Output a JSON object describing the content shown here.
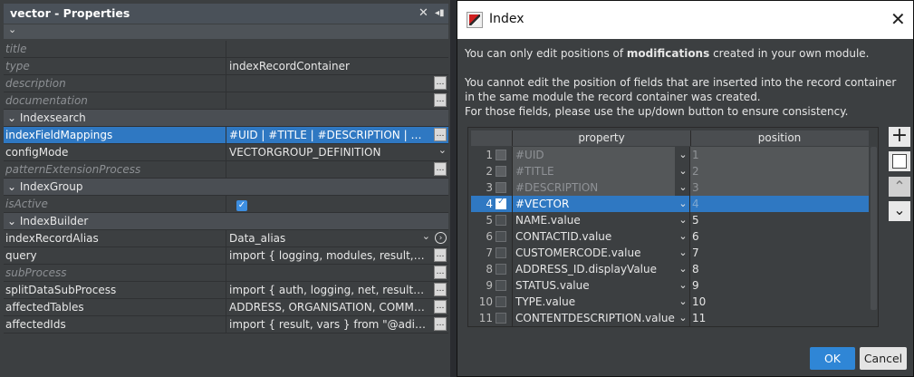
{
  "properties": {
    "title": "vector - Properties",
    "rows": [
      {
        "label": "title",
        "value": "",
        "muted": true,
        "ellipsis": false
      },
      {
        "label": "type",
        "value": "indexRecordContainer",
        "muted": true,
        "ellipsis": false
      },
      {
        "label": "description",
        "value": "",
        "muted": true,
        "ellipsis": true
      },
      {
        "label": "documentation",
        "value": "",
        "muted": true,
        "ellipsis": true
      }
    ],
    "sections": {
      "indexsearch": "Indexsearch",
      "indexgroup": "IndexGroup",
      "indexbuilder": "IndexBuilder"
    },
    "indexFieldMappings": {
      "label": "indexFieldMappings",
      "value": "#UID | #TITLE | #DESCRIPTION | #VECTOR"
    },
    "configMode": {
      "label": "configMode",
      "value": "VECTORGROUP_DEFINITION"
    },
    "patternExtensionProcess": {
      "label": "patternExtensionProcess",
      "value": ""
    },
    "isActive": {
      "label": "isActive",
      "checked": true
    },
    "indexRecordAlias": {
      "label": "indexRecordAlias",
      "value": "Data_alias"
    },
    "query": {
      "label": "query",
      "value": "import { logging, modules, result, SQLBuilder }"
    },
    "subProcess": {
      "label": "subProcess",
      "value": ""
    },
    "splitDataSubProcess": {
      "label": "splitDataSubProcess",
      "value": "import { auth, logging, net, result, util, vars }"
    },
    "affectedTables": {
      "label": "affectedTables",
      "value": "ADDRESS, ORGANISATION, COMMUNICATION"
    },
    "affectedIds": {
      "label": "affectedIds",
      "value": "import { result, vars } from \"@aditosoftware\""
    }
  },
  "dialog": {
    "title": "Index",
    "msg1_pre": "You can only edit positions of ",
    "msg1_bold": "modifications",
    "msg1_post": " created in your own module.",
    "msg2": "You cannot edit the position of fields that are inserted into the record container",
    "msg3": "in the same module the record container was created.",
    "msg4": "For those fields, please use the up/down button to ensure consistency.",
    "columns": {
      "property": "property",
      "position": "position"
    },
    "rows": [
      {
        "n": "1",
        "property": "#UID",
        "position": "1",
        "state": "dis"
      },
      {
        "n": "2",
        "property": "#TITLE",
        "position": "2",
        "state": "dis"
      },
      {
        "n": "3",
        "property": "#DESCRIPTION",
        "position": "3",
        "state": "dis"
      },
      {
        "n": "4",
        "property": "#VECTOR",
        "position": "4",
        "state": "sel"
      },
      {
        "n": "5",
        "property": "NAME.value",
        "position": "5",
        "state": ""
      },
      {
        "n": "6",
        "property": "CONTACTID.value",
        "position": "6",
        "state": ""
      },
      {
        "n": "7",
        "property": "CUSTOMERCODE.value",
        "position": "7",
        "state": ""
      },
      {
        "n": "8",
        "property": "ADDRESS_ID.displayValue",
        "position": "8",
        "state": ""
      },
      {
        "n": "9",
        "property": "STATUS.value",
        "position": "9",
        "state": ""
      },
      {
        "n": "10",
        "property": "TYPE.value",
        "position": "10",
        "state": ""
      },
      {
        "n": "11",
        "property": "CONTENTDESCRIPTION.value",
        "position": "11",
        "state": ""
      }
    ],
    "ok": "OK",
    "cancel": "Cancel"
  }
}
